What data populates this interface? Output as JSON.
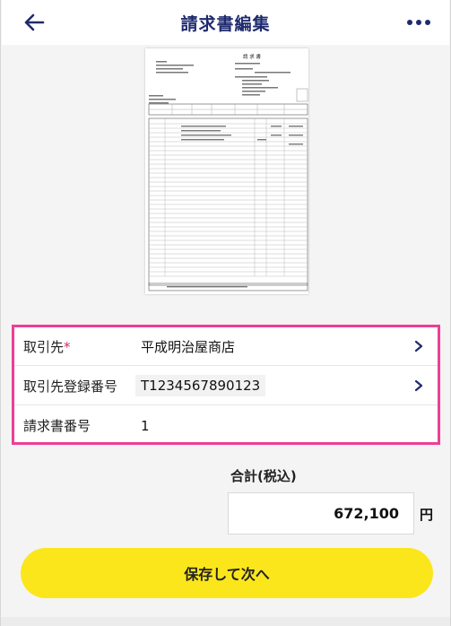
{
  "header": {
    "title": "請求書編集",
    "back_icon": "arrow-left-icon",
    "menu_icon": "more-horizontal-icon"
  },
  "preview": {
    "doc_title": "請 求 書"
  },
  "details": {
    "rows": [
      {
        "label": "取引先",
        "required_mark": "*",
        "value": "平成明治屋商店",
        "has_chevron": true
      },
      {
        "label": "取引先登録番号",
        "value": "T1234567890123",
        "has_chevron": true
      },
      {
        "label": "請求書番号",
        "value": "1",
        "has_chevron": false
      }
    ]
  },
  "total": {
    "label": "合計(税込)",
    "amount": "672,100",
    "unit": "円"
  },
  "actions": {
    "save_next_label": "保存して次へ"
  },
  "colors": {
    "title": "#1f2a6e",
    "highlight_border": "#ee3e96",
    "primary_button": "#fbe61c"
  }
}
